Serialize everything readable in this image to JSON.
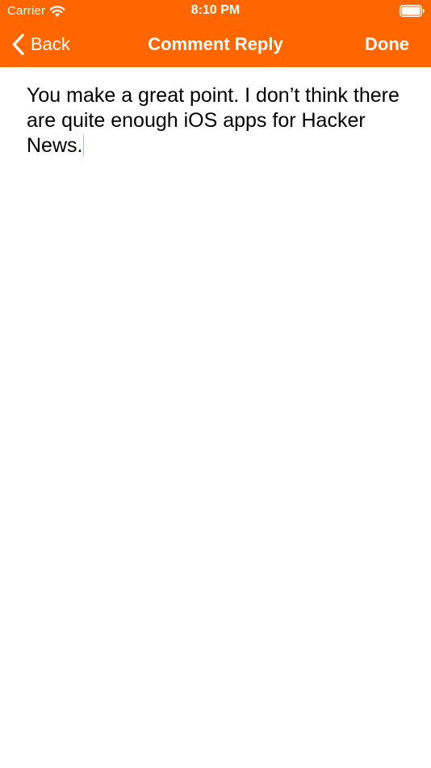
{
  "status_bar": {
    "carrier": "Carrier",
    "time": "8:10 PM",
    "wifi_icon": "wifi-icon",
    "battery_icon": "battery-icon"
  },
  "nav_bar": {
    "back_label": "Back",
    "back_icon": "chevron-left-icon",
    "title": "Comment Reply",
    "done_label": "Done"
  },
  "editor": {
    "text": "You make a great point. I don’t think there are quite enough iOS apps for Hacker News."
  },
  "colors": {
    "accent": "#ff6600",
    "text": "#000000",
    "background": "#ffffff"
  }
}
